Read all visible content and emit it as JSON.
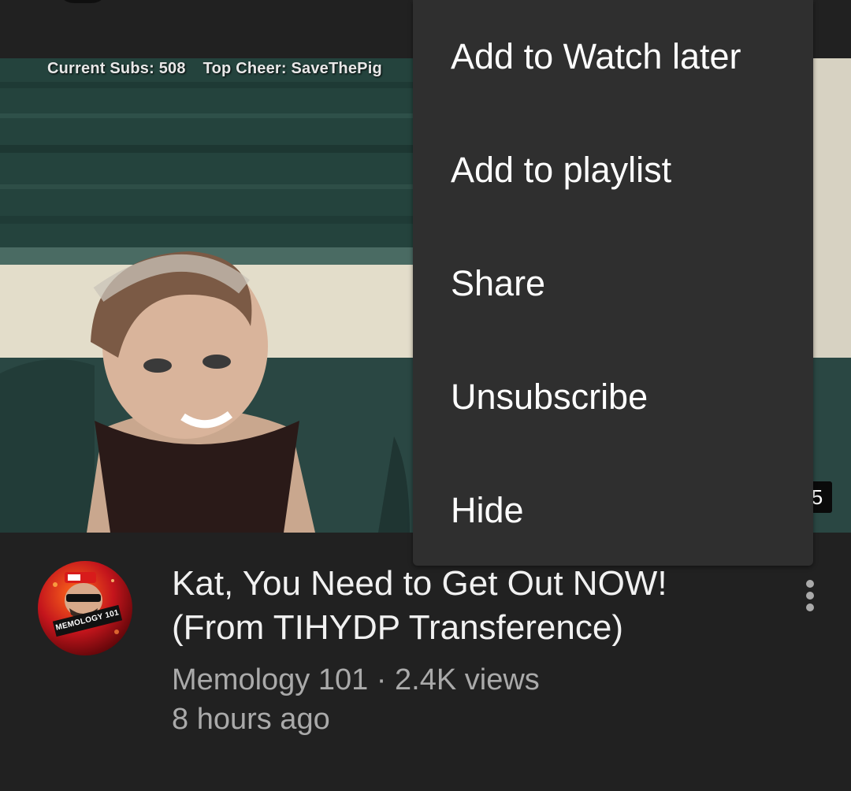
{
  "thumbnail": {
    "overlay": {
      "subs": "Current Subs: 508",
      "cheer": "Top Cheer: SaveThePig"
    },
    "duration_fragment": "5"
  },
  "menu": {
    "items": [
      {
        "label": "Add to Watch later"
      },
      {
        "label": "Add to playlist"
      },
      {
        "label": "Share"
      },
      {
        "label": "Unsubscribe"
      },
      {
        "label": "Hide"
      }
    ]
  },
  "video": {
    "title": "Kat, You Need to Get Out NOW! (From TIHYDP Transference)",
    "channel_avatar_text": "MEMOLOGY 101",
    "channel": "Memology 101",
    "separator": " · ",
    "views": "2.4K views",
    "age": "8 hours ago"
  },
  "icons": {
    "more": "more-vert-icon"
  },
  "colors": {
    "background": "#212121",
    "menu_background": "#2f2f2f",
    "primary_text": "#f1f1f1",
    "secondary_text": "#aaaaaa"
  }
}
